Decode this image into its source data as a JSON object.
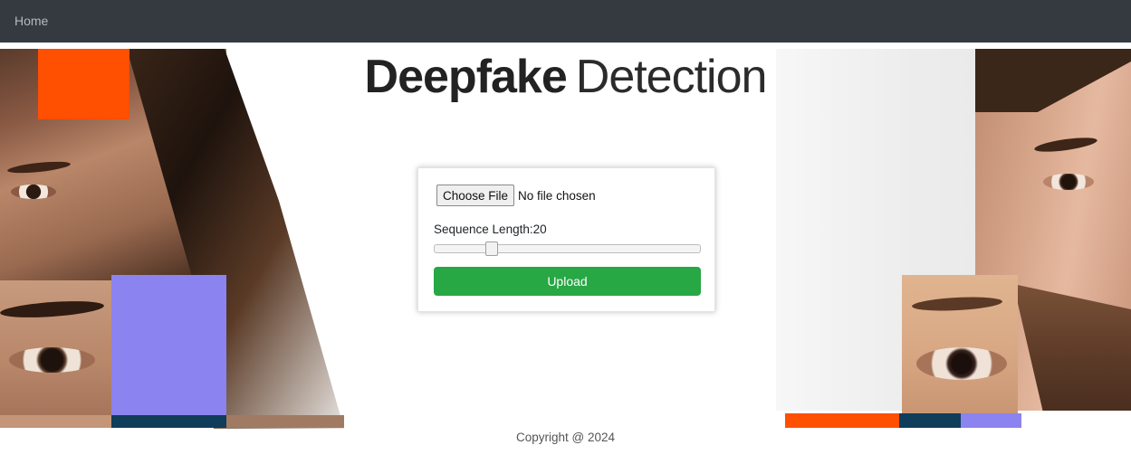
{
  "navbar": {
    "home_label": "Home"
  },
  "hero": {
    "title_bold": "Deepfake",
    "title_light": "Detection"
  },
  "upload_form": {
    "file_button_label": "Choose File",
    "file_status": "No file chosen",
    "sequence_length_label": "Sequence Length:20",
    "sequence_length_value": 20,
    "slider_position_fraction": 0.2,
    "upload_label": "Upload"
  },
  "footer": {
    "copyright": "Copyright @ 2024"
  },
  "colors": {
    "navbar": "#343a40",
    "upload_button": "#28a745",
    "accent_orange": "#ff4f00",
    "accent_purple": "#8b83f0",
    "accent_navy": "#0f3d5a"
  }
}
